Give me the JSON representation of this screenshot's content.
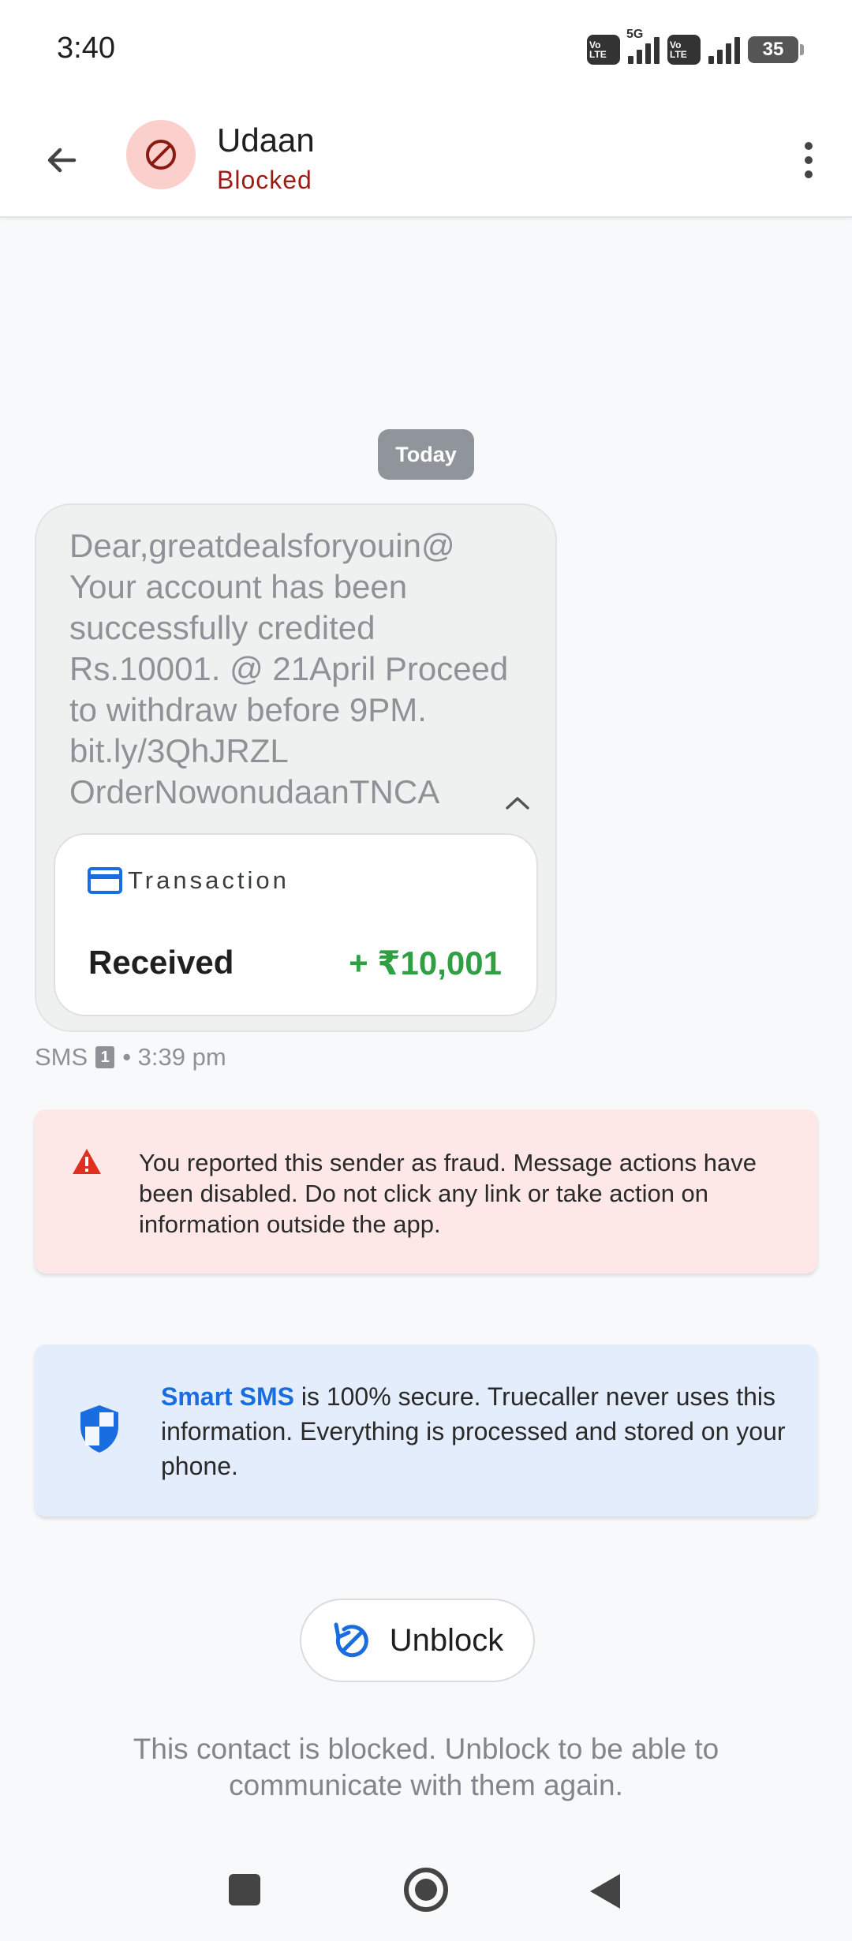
{
  "status_bar": {
    "time": "3:40",
    "volte_1": "Vo LTE",
    "network_type": "5G",
    "volte_2": "Vo LTE",
    "battery_level": "35"
  },
  "header": {
    "contact_name": "Udaan",
    "contact_status": "Blocked",
    "status_color": "#9c1c13",
    "avatar_color": "#fbd0cc"
  },
  "conversation": {
    "date_chip": "Today",
    "message": {
      "body": "Dear,greatdealsforyouin@ Your account has been successfully credited Rs.10001. @ 21April Proceed to withdraw before 9PM. bit.ly/3QhJRZL OrderNowonudaanTNCA",
      "transaction": {
        "title": "Transaction",
        "label": "Received",
        "amount": "+ ₹10,001",
        "amount_color": "#2ea043"
      },
      "channel": "SMS",
      "sim": "1",
      "time": "• 3:39 pm"
    }
  },
  "fraud_notice": {
    "text": "You reported this sender as fraud. Message actions have been disabled. Do not click any link or take action on information outside the app.",
    "background": "#fde8e7"
  },
  "security_notice": {
    "highlight": "Smart SMS",
    "text": " is 100% secure. Truecaller never uses this information. Everything is processed and stored on your phone.",
    "highlight_color": "#1a6de0"
  },
  "unblock": {
    "button_label": "Unblock",
    "info": "This contact is blocked. Unblock to be able to communicate with them again."
  },
  "icons": {
    "back": "arrow-left-icon",
    "avatar": "blocked-circle-icon",
    "more": "more-vertical-icon",
    "collapse": "chevron-up-icon",
    "card": "credit-card-icon",
    "warning": "warning-triangle-icon",
    "shield": "shield-icon",
    "unblock": "unblock-icon"
  }
}
